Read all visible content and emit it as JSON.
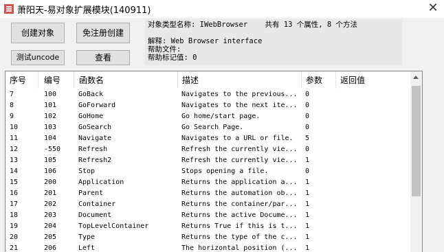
{
  "window": {
    "title": "萧阳天-易对象扩展模块(140911)",
    "close_symbol": "✕"
  },
  "buttons": {
    "create_object": "创建对象",
    "create_without_register": "免注册创建",
    "test_uncode": "测试uncode",
    "view": "查看"
  },
  "info": {
    "type_name": "对象类型名称: IWebBrowser    共有 13 个属性, 8 个方法",
    "explanation": "解释: Web Browser interface",
    "help_file": "帮助文件:",
    "help_context": "帮助标记值: 0"
  },
  "table": {
    "columns": [
      "序号",
      "编号",
      "函数名",
      "描述",
      "参数",
      "返回值"
    ],
    "rows": [
      [
        "7",
        "100",
        "GoBack",
        "Navigates to the previous...",
        "0",
        ""
      ],
      [
        "8",
        "101",
        "GoForward",
        "Navigates to the next ite...",
        "0",
        ""
      ],
      [
        "9",
        "102",
        "GoHome",
        "Go home/start page.",
        "0",
        ""
      ],
      [
        "10",
        "103",
        "GoSearch",
        "Go Search Page.",
        "0",
        ""
      ],
      [
        "11",
        "104",
        "Navigate",
        "Navigates to a URL or file.",
        "5",
        ""
      ],
      [
        "12",
        "-550",
        "Refresh",
        "Refresh the currently vie...",
        "0",
        ""
      ],
      [
        "13",
        "105",
        "Refresh2",
        "Refresh the currently vie...",
        "1",
        ""
      ],
      [
        "14",
        "106",
        "Stop",
        "Stops opening a file.",
        "0",
        ""
      ],
      [
        "15",
        "200",
        "Application",
        "Returns the application a...",
        "1",
        ""
      ],
      [
        "16",
        "201",
        "Parent",
        "Returns the automation ob...",
        "1",
        ""
      ],
      [
        "17",
        "202",
        "Container",
        "Returns the container/par...",
        "1",
        ""
      ],
      [
        "18",
        "203",
        "Document",
        "Returns the active Docume...",
        "1",
        ""
      ],
      [
        "19",
        "204",
        "TopLevelContainer",
        "Returns True if this is t...",
        "1",
        ""
      ],
      [
        "20",
        "205",
        "Type",
        "Returns the type of the c...",
        "1",
        ""
      ],
      [
        "21",
        "206",
        "Left",
        "The horizontal position (...",
        "1",
        ""
      ]
    ]
  },
  "colors": {
    "window_bg": "#f0f0f0",
    "button_bg": "#e1e1e1",
    "icon_accent": "#d9534f"
  }
}
